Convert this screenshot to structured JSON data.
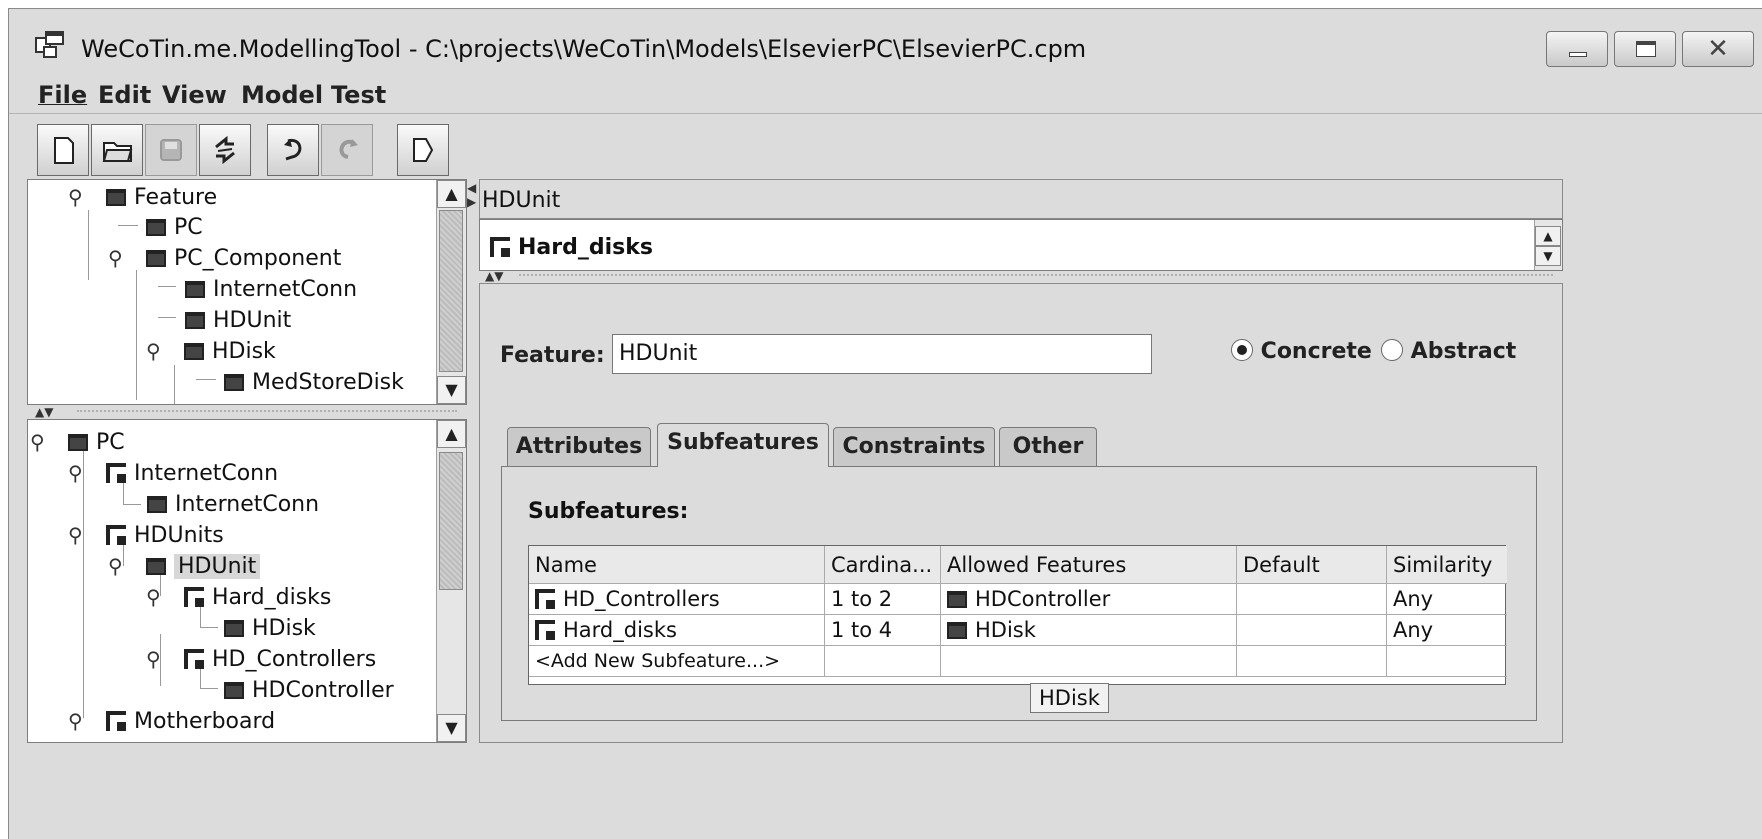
{
  "window": {
    "title": "WeCoTin.me.ModellingTool - C:\\projects\\WeCoTin\\Models\\ElsevierPC\\ElsevierPC.cpm"
  },
  "menu": [
    "File",
    "Edit",
    "View",
    "Model",
    "Test"
  ],
  "toolbar": {
    "buttons": [
      {
        "icon": "new-file-icon",
        "enabled": true
      },
      {
        "icon": "open-folder-icon",
        "enabled": true
      },
      {
        "icon": "save-icon",
        "enabled": false
      },
      {
        "icon": "refresh-icon",
        "enabled": true
      },
      {
        "icon": "undo-icon",
        "enabled": true
      },
      {
        "icon": "redo-icon",
        "enabled": false
      },
      {
        "icon": "export-icon",
        "enabled": true
      }
    ]
  },
  "type_tree": [
    {
      "label": "Feature",
      "depth": 0,
      "expanded": true
    },
    {
      "label": "PC",
      "depth": 1
    },
    {
      "label": "PC_Component",
      "depth": 1,
      "expanded": true
    },
    {
      "label": "InternetConn",
      "depth": 2
    },
    {
      "label": "HDUnit",
      "depth": 2
    },
    {
      "label": "HDisk",
      "depth": 2,
      "expanded": true
    },
    {
      "label": "MedStoreDisk",
      "depth": 3
    }
  ],
  "structure_tree": [
    {
      "label": "PC",
      "icon": "node",
      "depth": 0,
      "expanded": true
    },
    {
      "label": "InternetConn",
      "icon": "group",
      "depth": 1,
      "expanded": true
    },
    {
      "label": "InternetConn",
      "icon": "node",
      "depth": 2
    },
    {
      "label": "HDUnits",
      "icon": "group",
      "depth": 1,
      "expanded": true
    },
    {
      "label": "HDUnit",
      "icon": "node",
      "depth": 2,
      "expanded": true,
      "selected": true
    },
    {
      "label": "Hard_disks",
      "icon": "group",
      "depth": 3,
      "expanded": true
    },
    {
      "label": "HDisk",
      "icon": "node",
      "depth": 4
    },
    {
      "label": "HD_Controllers",
      "icon": "group",
      "depth": 3,
      "expanded": true
    },
    {
      "label": "HDController",
      "icon": "node",
      "depth": 4
    },
    {
      "label": "Motherboard",
      "icon": "group",
      "depth": 1,
      "expanded": true
    }
  ],
  "detail": {
    "header": "HDUnit",
    "list_item": "Hard_disks",
    "feature_label": "Feature:",
    "feature_value": "HDUnit",
    "radio": {
      "concrete": "Concrete",
      "abstract": "Abstract",
      "selected": "Concrete"
    },
    "tabs": [
      "Attributes",
      "Subfeatures",
      "Constraints",
      "Other"
    ],
    "active_tab": "Subfeatures",
    "section_title": "Subfeatures:",
    "table": {
      "columns": [
        "Name",
        "Cardina...",
        "Allowed Features",
        "Default",
        "Similarity"
      ],
      "rows": [
        {
          "name": "HD_Controllers",
          "cardinality": "1 to 2",
          "allowed": "HDController",
          "default": "",
          "similarity": "Any"
        },
        {
          "name": "Hard_disks",
          "cardinality": "1 to 4",
          "allowed": "HDisk",
          "default": "",
          "similarity": "Any"
        },
        {
          "name": "<Add New Subfeature...>",
          "cardinality": "",
          "allowed": "",
          "default": "",
          "similarity": ""
        }
      ]
    },
    "tooltip": "HDisk"
  }
}
